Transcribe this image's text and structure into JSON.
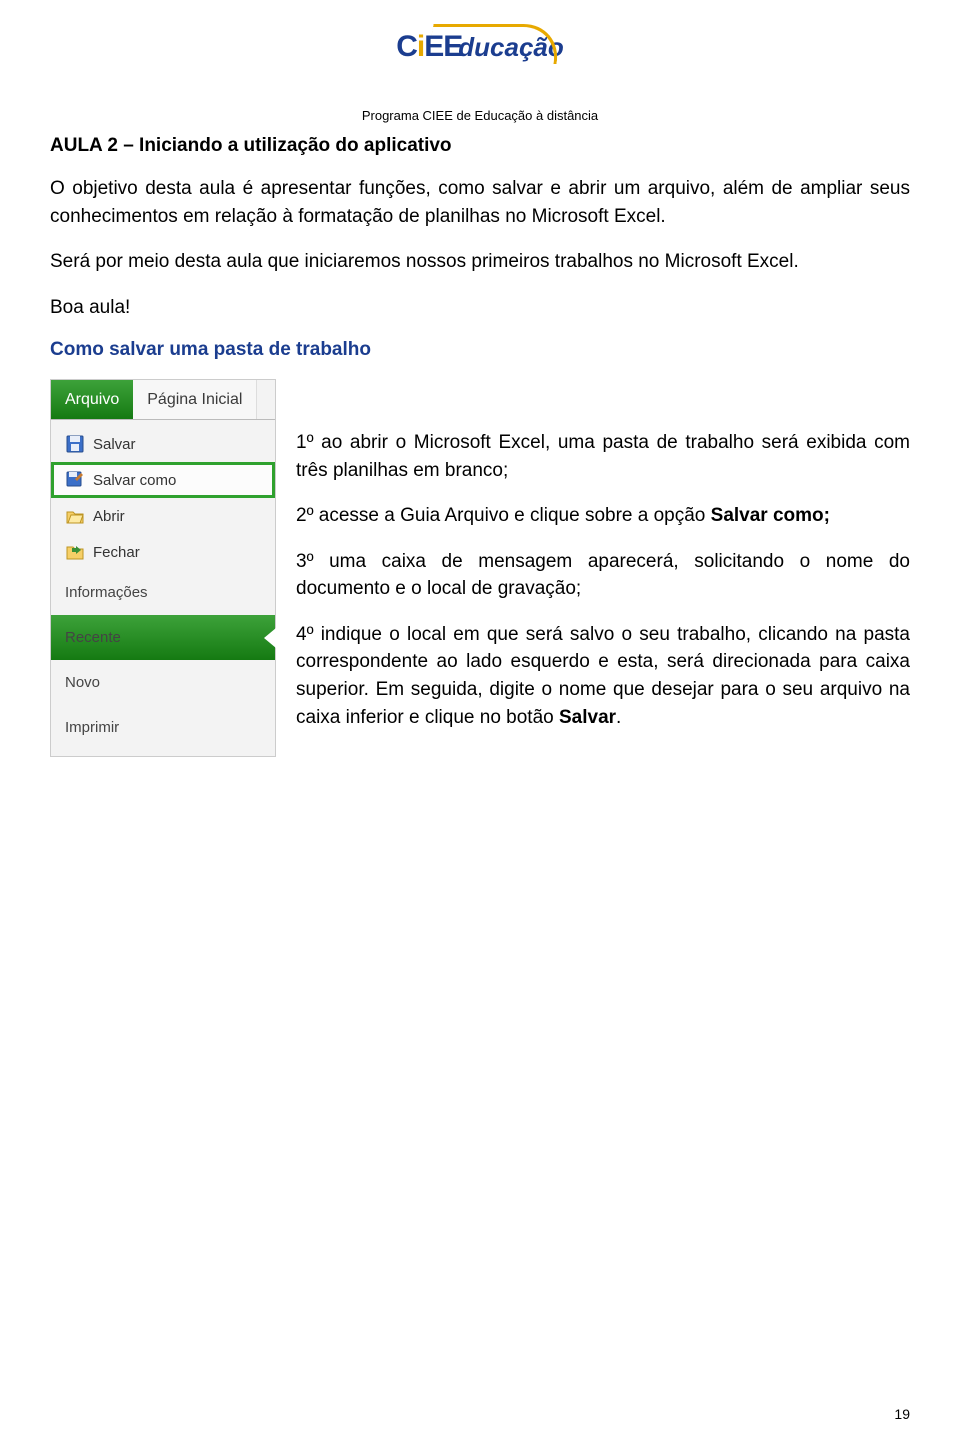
{
  "program_line": "Programa CIEE de Educação à distância",
  "title": "AULA 2 – Iniciando a utilização do aplicativo",
  "p1": "O objetivo desta aula é apresentar funções, como salvar e abrir um arquivo, além de ampliar seus conhecimentos em relação à formatação de planilhas no Microsoft Excel.",
  "p2": "Será por meio desta aula que iniciaremos nossos primeiros trabalhos no Microsoft Excel.",
  "p3": "Boa aula!",
  "subtitle": "Como salvar uma pasta de trabalho",
  "menu": {
    "tab_active": "Arquivo",
    "tab_inactive": "Página Inicial",
    "items": [
      {
        "label": "Salvar",
        "icon": "save-icon"
      },
      {
        "label": "Salvar como",
        "icon": "save-as-icon",
        "highlight": true
      },
      {
        "label": "Abrir",
        "icon": "open-icon"
      },
      {
        "label": "Fechar",
        "icon": "close-file-icon"
      }
    ],
    "big_items": [
      {
        "label": "Informações"
      },
      {
        "label": "Recente",
        "recent": true
      },
      {
        "label": "Novo"
      },
      {
        "label": "Imprimir"
      }
    ]
  },
  "steps": {
    "s1": "1º ao abrir o Microsoft Excel, uma pasta de trabalho será exibida com três planilhas em branco;",
    "s2_pre": "2º acesse a Guia Arquivo e clique sobre a opção ",
    "s2_bold": "Salvar como;",
    "s3": "3º uma caixa de mensagem aparecerá, solicitando o nome do documento e o local de gravação;",
    "s4_pre": "4º indique o local em que será salvo o seu trabalho, clicando na pasta correspondente ao lado esquerdo e esta, será direcionada para caixa superior. Em seguida, digite o nome que desejar para o seu arquivo na caixa inferior e clique no botão ",
    "s4_bold": "Salvar",
    "s4_post": "."
  },
  "pagenum": "19",
  "logo": {
    "main": "CiE",
    "edu": "ducação"
  }
}
